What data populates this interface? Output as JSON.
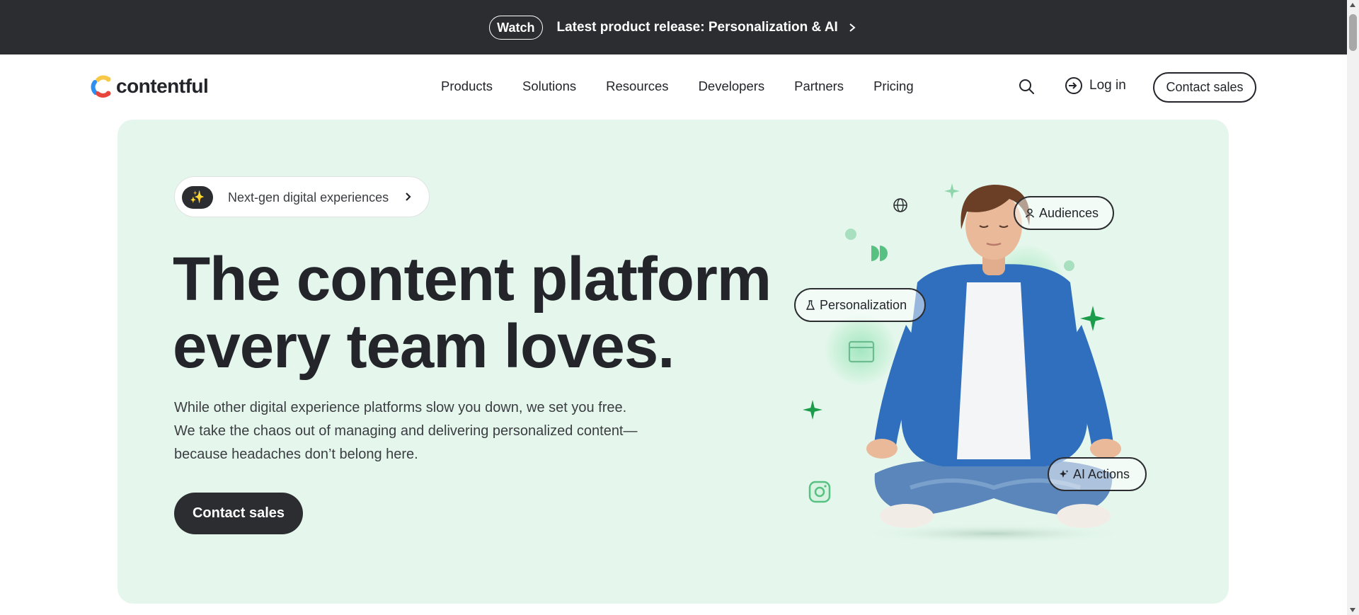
{
  "announcement": {
    "watch_label": "Watch",
    "release_text": "Latest product release: Personalization & AI"
  },
  "nav": {
    "logo_text": "contentful",
    "links": [
      "Products",
      "Solutions",
      "Resources",
      "Developers",
      "Partners",
      "Pricing"
    ],
    "login_label": "Log in",
    "contact_label": "Contact sales"
  },
  "hero": {
    "eyebrow": "Next-gen digital experiences",
    "headline_line1": "The content platform",
    "headline_line2": "every team loves.",
    "subcopy": "While other digital experience platforms slow you down, we set you free. We take the chaos out of managing and delivering personalized content—because headaches don’t belong here.",
    "cta_label": "Contact sales"
  },
  "illustration": {
    "pills": {
      "audiences": "Audiences",
      "personalization": "Personalization",
      "ai_actions": "AI Actions"
    }
  },
  "icons": {
    "search": "search-icon",
    "login": "login-icon",
    "sparkle": "sparkle-icon",
    "chevron": "chevron-right-icon"
  },
  "colors": {
    "topbar_bg": "#2c2d31",
    "hero_bg": "#e5f7ec",
    "accent_green": "#1a9c4b",
    "dark": "#23252b"
  }
}
